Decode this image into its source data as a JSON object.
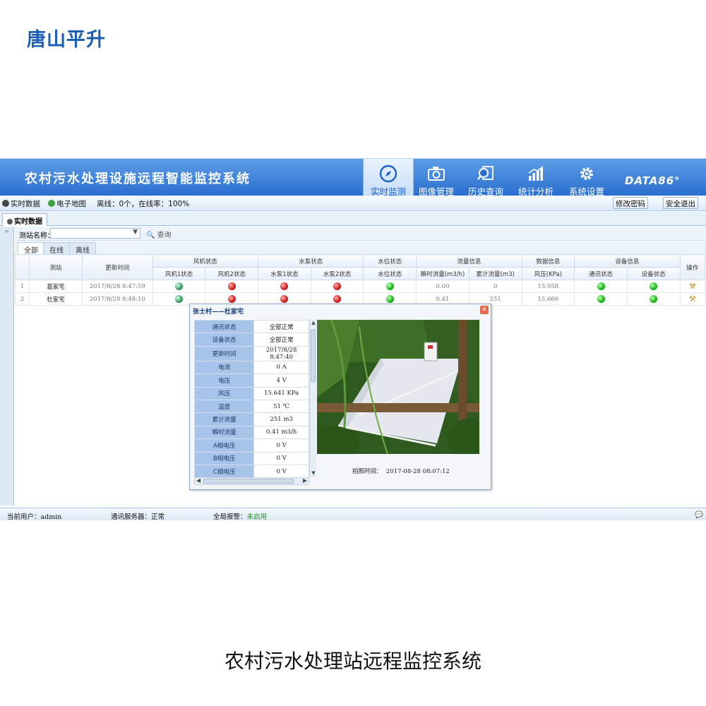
{
  "brand": "唐山平升",
  "caption": "农村污水处理站远程监控系统",
  "header": {
    "title": "农村污水处理设施远程智能监控系统",
    "nav": [
      {
        "label": "实时监测",
        "icon": "compass-icon",
        "active": true
      },
      {
        "label": "图像管理",
        "icon": "camera-icon",
        "active": false
      },
      {
        "label": "历史查询",
        "icon": "magnifier-icon",
        "active": false
      },
      {
        "label": "统计分析",
        "icon": "bar-chart-icon",
        "active": false
      },
      {
        "label": "系统设置",
        "icon": "gear-icon",
        "active": false
      }
    ],
    "logo": "DATA86",
    "logo_mark": "®"
  },
  "toolbar": {
    "realtime": "实时数据",
    "map": "电子地图",
    "status_text": "离线：0个，在线率：100%",
    "change_pwd": "修改密码",
    "logout": "安全退出"
  },
  "main_tab": "实时数据",
  "search": {
    "label": "测站名称：",
    "query": "查询"
  },
  "filter_tabs": [
    "全部",
    "在线",
    "离线"
  ],
  "table": {
    "group_headers": [
      "测站",
      "更新时间",
      "风机状态",
      "水泵状态",
      "水位状态",
      "流量信息",
      "数据信息",
      "设备信息",
      "操作"
    ],
    "sub_headers": [
      "风机1状态",
      "风机2状态",
      "水泵1状态",
      "水泵2状态",
      "水位状态",
      "瞬时流量(m3/h)",
      "累计流量(m3)",
      "风压(KPa)",
      "通讯状态",
      "设备状态"
    ],
    "rows": [
      {
        "no": "1",
        "station": "葛家宅",
        "time": "2017/8/28 8:47:59",
        "fan1": "running",
        "fan2": "stopped",
        "pump1": "stopped",
        "pump2": "stopped",
        "water": "normal",
        "inst_flow": "0.00",
        "total_flow": "0",
        "pressure": "15.958",
        "comm": "normal",
        "device": "normal"
      },
      {
        "no": "2",
        "station": "杜家宅",
        "time": "2017/8/28 8:48:10",
        "fan1": "running",
        "fan2": "stopped",
        "pump1": "stopped",
        "pump2": "stopped",
        "water": "normal",
        "inst_flow": "0.41",
        "total_flow": "251",
        "pressure": "15.666",
        "comm": "normal",
        "device": "normal"
      }
    ]
  },
  "popup": {
    "title": "张士村——杜家宅",
    "fields": [
      {
        "k": "通讯状态",
        "v": "全部正常"
      },
      {
        "k": "设备状态",
        "v": "全部正常"
      },
      {
        "k": "更新时间",
        "v": "2017/8/28 8:47:40"
      },
      {
        "k": "电流",
        "v": "0 A"
      },
      {
        "k": "电压",
        "v": "4 V"
      },
      {
        "k": "风压",
        "v": "15.641 KPa"
      },
      {
        "k": "温度",
        "v": "51 ℃"
      },
      {
        "k": "累计流量",
        "v": "251 m3"
      },
      {
        "k": "瞬时流量",
        "v": "0.41 m3/h"
      },
      {
        "k": "A相电压",
        "v": "0 V"
      },
      {
        "k": "B相电压",
        "v": "0 V"
      },
      {
        "k": "C相电压",
        "v": "0 V"
      }
    ],
    "shot_label": "拍照时间：",
    "shot_time": "2017-08-28 08:07:12"
  },
  "statusbar": {
    "user_label": "当前用户：",
    "user": "admin",
    "server_label": "通讯服务器：",
    "server": "正常",
    "alarm_label": "全局报警：",
    "alarm": "未启用"
  },
  "colors": {
    "header": "#2a6fcf",
    "led_on": "#18b418",
    "led_off": "#d02525"
  }
}
